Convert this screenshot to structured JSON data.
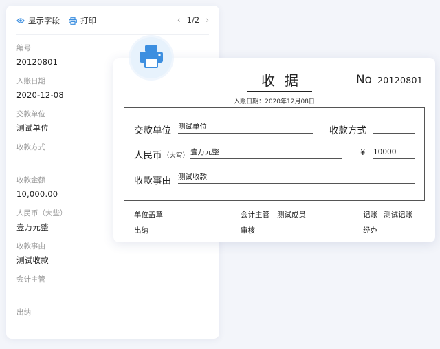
{
  "toolbar": {
    "show_fields_label": "显示字段",
    "print_label": "打印",
    "page_prev": "‹",
    "page_indicator": "1/2",
    "page_next": "›"
  },
  "fields": [
    {
      "label": "编号",
      "value": "20120801"
    },
    {
      "label": "入账日期",
      "value": "2020-12-08"
    },
    {
      "label": "交款单位",
      "value": "测试单位"
    },
    {
      "label": "收款方式",
      "value": ""
    },
    {
      "label": "收款金额",
      "value": "10,000.00"
    },
    {
      "label": "人民币（大些）",
      "value": "壹万元整"
    },
    {
      "label": "收款事由",
      "value": "测试收款"
    },
    {
      "label": "会计主管",
      "value": ""
    },
    {
      "label": "出纳",
      "value": ""
    }
  ],
  "receipt": {
    "title": "收据",
    "no_label": "No",
    "no_value": "20120801",
    "date_line": "入账日期：2020年12月08日",
    "payer_label": "交款单位",
    "payer_value": "测试单位",
    "method_label": "收款方式",
    "method_value": "",
    "rmb_label": "人民币",
    "rmb_hint": "（大写）",
    "rmb_value": "壹万元整",
    "yen_symbol": "¥",
    "amount_value": "10000",
    "reason_label": "收款事由",
    "reason_value": "测试收款",
    "footer": {
      "seal_label": "单位盖章",
      "accountant_label": "会计主管",
      "accountant_value": "测试成员",
      "bookkeeper_label": "记账",
      "bookkeeper_value": "测试记账",
      "cashier_label": "出纳",
      "review_label": "审核",
      "handler_label": "经办"
    }
  },
  "colors": {
    "accent": "#3d8fe0",
    "badge_bg": "#e7f2fc",
    "page_bg": "#f3f5fa"
  },
  "icons": [
    "eye-icon",
    "printer-icon",
    "chevron-left-icon",
    "chevron-right-icon",
    "printer-badge-icon"
  ]
}
